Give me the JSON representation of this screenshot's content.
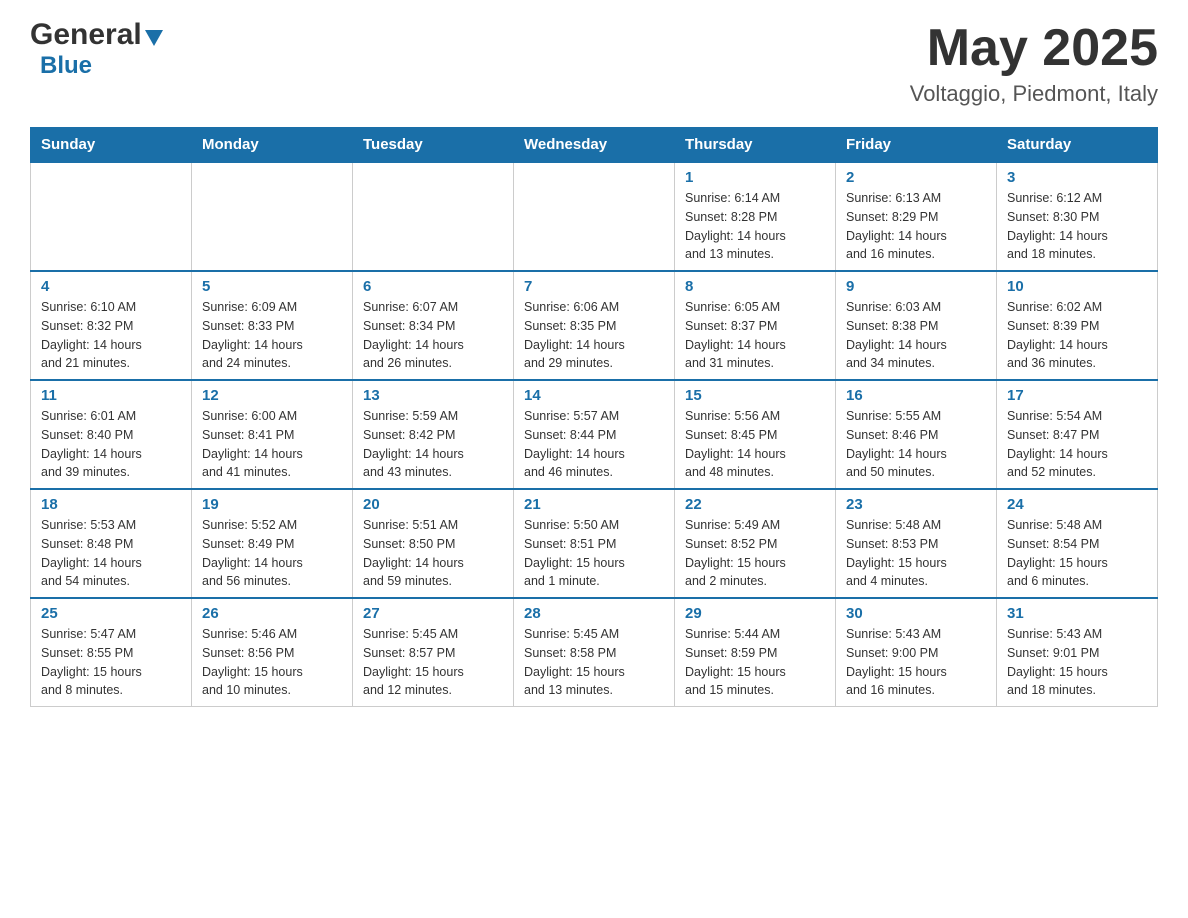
{
  "header": {
    "logo_general": "General",
    "logo_blue": "Blue",
    "title": "May 2025",
    "subtitle": "Voltaggio, Piedmont, Italy"
  },
  "days_of_week": [
    "Sunday",
    "Monday",
    "Tuesday",
    "Wednesday",
    "Thursday",
    "Friday",
    "Saturday"
  ],
  "weeks": [
    {
      "cells": [
        {
          "day": "",
          "info": ""
        },
        {
          "day": "",
          "info": ""
        },
        {
          "day": "",
          "info": ""
        },
        {
          "day": "",
          "info": ""
        },
        {
          "day": "1",
          "info": "Sunrise: 6:14 AM\nSunset: 8:28 PM\nDaylight: 14 hours\nand 13 minutes."
        },
        {
          "day": "2",
          "info": "Sunrise: 6:13 AM\nSunset: 8:29 PM\nDaylight: 14 hours\nand 16 minutes."
        },
        {
          "day": "3",
          "info": "Sunrise: 6:12 AM\nSunset: 8:30 PM\nDaylight: 14 hours\nand 18 minutes."
        }
      ]
    },
    {
      "cells": [
        {
          "day": "4",
          "info": "Sunrise: 6:10 AM\nSunset: 8:32 PM\nDaylight: 14 hours\nand 21 minutes."
        },
        {
          "day": "5",
          "info": "Sunrise: 6:09 AM\nSunset: 8:33 PM\nDaylight: 14 hours\nand 24 minutes."
        },
        {
          "day": "6",
          "info": "Sunrise: 6:07 AM\nSunset: 8:34 PM\nDaylight: 14 hours\nand 26 minutes."
        },
        {
          "day": "7",
          "info": "Sunrise: 6:06 AM\nSunset: 8:35 PM\nDaylight: 14 hours\nand 29 minutes."
        },
        {
          "day": "8",
          "info": "Sunrise: 6:05 AM\nSunset: 8:37 PM\nDaylight: 14 hours\nand 31 minutes."
        },
        {
          "day": "9",
          "info": "Sunrise: 6:03 AM\nSunset: 8:38 PM\nDaylight: 14 hours\nand 34 minutes."
        },
        {
          "day": "10",
          "info": "Sunrise: 6:02 AM\nSunset: 8:39 PM\nDaylight: 14 hours\nand 36 minutes."
        }
      ]
    },
    {
      "cells": [
        {
          "day": "11",
          "info": "Sunrise: 6:01 AM\nSunset: 8:40 PM\nDaylight: 14 hours\nand 39 minutes."
        },
        {
          "day": "12",
          "info": "Sunrise: 6:00 AM\nSunset: 8:41 PM\nDaylight: 14 hours\nand 41 minutes."
        },
        {
          "day": "13",
          "info": "Sunrise: 5:59 AM\nSunset: 8:42 PM\nDaylight: 14 hours\nand 43 minutes."
        },
        {
          "day": "14",
          "info": "Sunrise: 5:57 AM\nSunset: 8:44 PM\nDaylight: 14 hours\nand 46 minutes."
        },
        {
          "day": "15",
          "info": "Sunrise: 5:56 AM\nSunset: 8:45 PM\nDaylight: 14 hours\nand 48 minutes."
        },
        {
          "day": "16",
          "info": "Sunrise: 5:55 AM\nSunset: 8:46 PM\nDaylight: 14 hours\nand 50 minutes."
        },
        {
          "day": "17",
          "info": "Sunrise: 5:54 AM\nSunset: 8:47 PM\nDaylight: 14 hours\nand 52 minutes."
        }
      ]
    },
    {
      "cells": [
        {
          "day": "18",
          "info": "Sunrise: 5:53 AM\nSunset: 8:48 PM\nDaylight: 14 hours\nand 54 minutes."
        },
        {
          "day": "19",
          "info": "Sunrise: 5:52 AM\nSunset: 8:49 PM\nDaylight: 14 hours\nand 56 minutes."
        },
        {
          "day": "20",
          "info": "Sunrise: 5:51 AM\nSunset: 8:50 PM\nDaylight: 14 hours\nand 59 minutes."
        },
        {
          "day": "21",
          "info": "Sunrise: 5:50 AM\nSunset: 8:51 PM\nDaylight: 15 hours\nand 1 minute."
        },
        {
          "day": "22",
          "info": "Sunrise: 5:49 AM\nSunset: 8:52 PM\nDaylight: 15 hours\nand 2 minutes."
        },
        {
          "day": "23",
          "info": "Sunrise: 5:48 AM\nSunset: 8:53 PM\nDaylight: 15 hours\nand 4 minutes."
        },
        {
          "day": "24",
          "info": "Sunrise: 5:48 AM\nSunset: 8:54 PM\nDaylight: 15 hours\nand 6 minutes."
        }
      ]
    },
    {
      "cells": [
        {
          "day": "25",
          "info": "Sunrise: 5:47 AM\nSunset: 8:55 PM\nDaylight: 15 hours\nand 8 minutes."
        },
        {
          "day": "26",
          "info": "Sunrise: 5:46 AM\nSunset: 8:56 PM\nDaylight: 15 hours\nand 10 minutes."
        },
        {
          "day": "27",
          "info": "Sunrise: 5:45 AM\nSunset: 8:57 PM\nDaylight: 15 hours\nand 12 minutes."
        },
        {
          "day": "28",
          "info": "Sunrise: 5:45 AM\nSunset: 8:58 PM\nDaylight: 15 hours\nand 13 minutes."
        },
        {
          "day": "29",
          "info": "Sunrise: 5:44 AM\nSunset: 8:59 PM\nDaylight: 15 hours\nand 15 minutes."
        },
        {
          "day": "30",
          "info": "Sunrise: 5:43 AM\nSunset: 9:00 PM\nDaylight: 15 hours\nand 16 minutes."
        },
        {
          "day": "31",
          "info": "Sunrise: 5:43 AM\nSunset: 9:01 PM\nDaylight: 15 hours\nand 18 minutes."
        }
      ]
    }
  ],
  "colors": {
    "header_bg": "#1a6fa8",
    "header_text": "#ffffff",
    "day_num": "#1a6fa8",
    "border": "#cccccc"
  }
}
